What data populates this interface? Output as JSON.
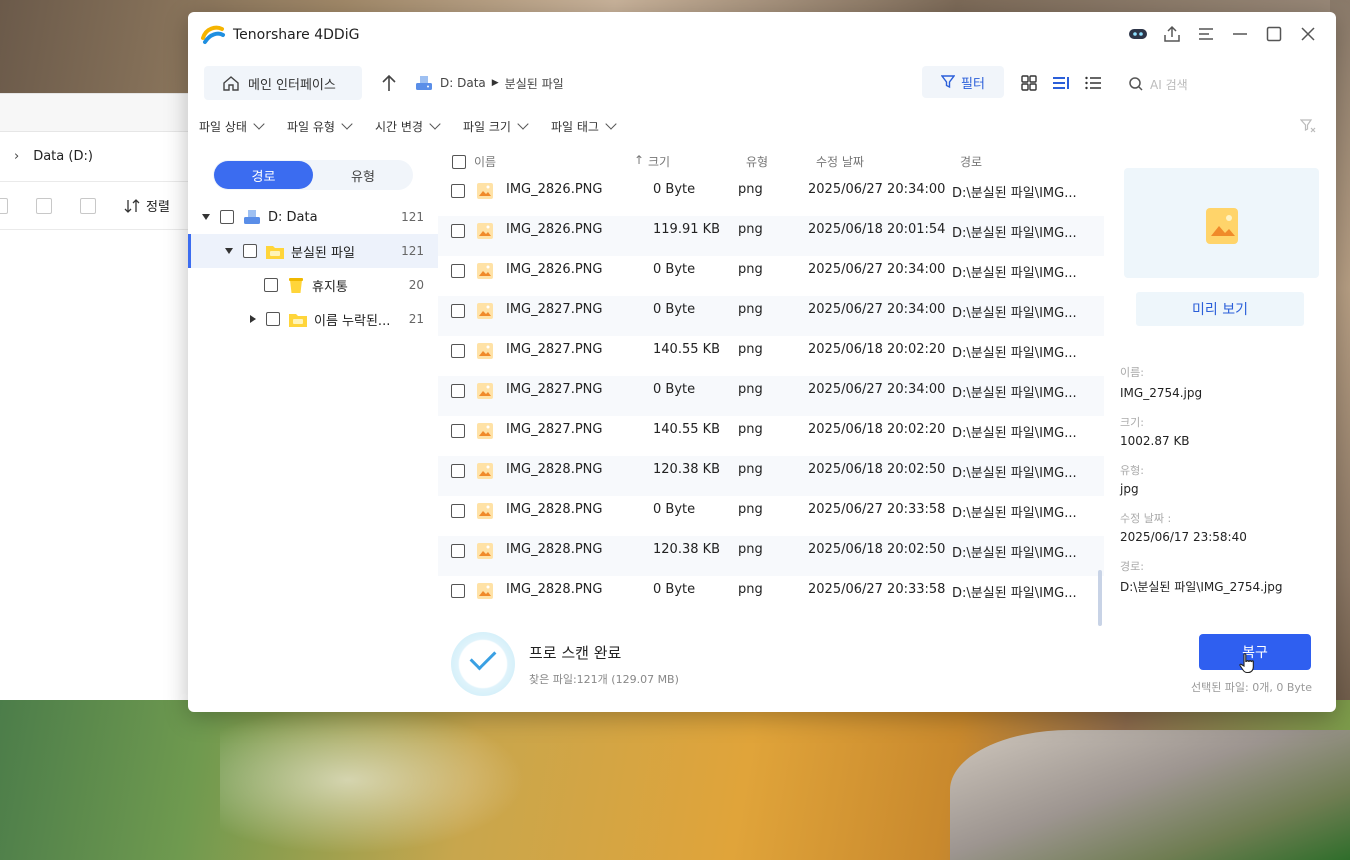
{
  "explorer": {
    "location": "Data (D:)",
    "sort_label": "정렬"
  },
  "app": {
    "title": "Tenorshare 4DDiG",
    "home_label": "메인 인터페이스",
    "breadcrumb": [
      "D: Data",
      "분실된 파일"
    ],
    "filter_label": "필터",
    "search_placeholder": "AI 검색",
    "filters": [
      "파일 상태",
      "파일 유형",
      "시간 변경",
      "파일 크기",
      "파일 태그"
    ]
  },
  "tree": {
    "tabs": [
      "경로",
      "유형"
    ],
    "active_tab": "경로",
    "nodes": [
      {
        "label": "D: Data",
        "count": "121"
      },
      {
        "label": "분실된 파일",
        "count": "121"
      },
      {
        "label": "휴지통",
        "count": "20"
      },
      {
        "label": "이름 누락된...",
        "count": "21"
      }
    ]
  },
  "table": {
    "columns": [
      "이름",
      "크기",
      "유형",
      "수정 날짜",
      "경로"
    ],
    "rows": [
      {
        "name": "IMG_2826.PNG",
        "size": "0 Byte",
        "type": "png",
        "date": "2025/06/27 20:34:00",
        "path": "D:\\분실된 파일\\IMG..."
      },
      {
        "name": "IMG_2826.PNG",
        "size": "119.91 KB",
        "type": "png",
        "date": "2025/06/18 20:01:54",
        "path": "D:\\분실된 파일\\IMG..."
      },
      {
        "name": "IMG_2826.PNG",
        "size": "0 Byte",
        "type": "png",
        "date": "2025/06/27 20:34:00",
        "path": "D:\\분실된 파일\\IMG..."
      },
      {
        "name": "IMG_2827.PNG",
        "size": "0 Byte",
        "type": "png",
        "date": "2025/06/27 20:34:00",
        "path": "D:\\분실된 파일\\IMG..."
      },
      {
        "name": "IMG_2827.PNG",
        "size": "140.55 KB",
        "type": "png",
        "date": "2025/06/18 20:02:20",
        "path": "D:\\분실된 파일\\IMG..."
      },
      {
        "name": "IMG_2827.PNG",
        "size": "0 Byte",
        "type": "png",
        "date": "2025/06/27 20:34:00",
        "path": "D:\\분실된 파일\\IMG..."
      },
      {
        "name": "IMG_2827.PNG",
        "size": "140.55 KB",
        "type": "png",
        "date": "2025/06/18 20:02:20",
        "path": "D:\\분실된 파일\\IMG..."
      },
      {
        "name": "IMG_2828.PNG",
        "size": "120.38 KB",
        "type": "png",
        "date": "2025/06/18 20:02:50",
        "path": "D:\\분실된 파일\\IMG..."
      },
      {
        "name": "IMG_2828.PNG",
        "size": "0 Byte",
        "type": "png",
        "date": "2025/06/27 20:33:58",
        "path": "D:\\분실된 파일\\IMG..."
      },
      {
        "name": "IMG_2828.PNG",
        "size": "120.38 KB",
        "type": "png",
        "date": "2025/06/18 20:02:50",
        "path": "D:\\분실된 파일\\IMG..."
      },
      {
        "name": "IMG_2828.PNG",
        "size": "0 Byte",
        "type": "png",
        "date": "2025/06/27 20:33:58",
        "path": "D:\\분실된 파일\\IMG..."
      }
    ]
  },
  "preview": {
    "button_label": "미리 보기",
    "fields": [
      {
        "label": "이름:",
        "value": "IMG_2754.jpg"
      },
      {
        "label": "크기:",
        "value": "1002.87 KB"
      },
      {
        "label": "유형:",
        "value": "jpg"
      },
      {
        "label": "수정 날짜 :",
        "value": "2025/06/17 23:58:40"
      },
      {
        "label": "경로:",
        "value": "D:\\분실된 파일\\IMG_2754.jpg"
      }
    ]
  },
  "footer": {
    "scan_title": "프로 스캔 완료",
    "scan_summary": "찾은 파일:121개 (129.07 MB)",
    "recover_label": "복구",
    "selected_info": "선택된 파일: 0개, 0 Byte"
  },
  "colors": {
    "accent": "#3b6cf0",
    "recover": "#2f5ff0",
    "panel_bg": "#f1f5fa"
  }
}
